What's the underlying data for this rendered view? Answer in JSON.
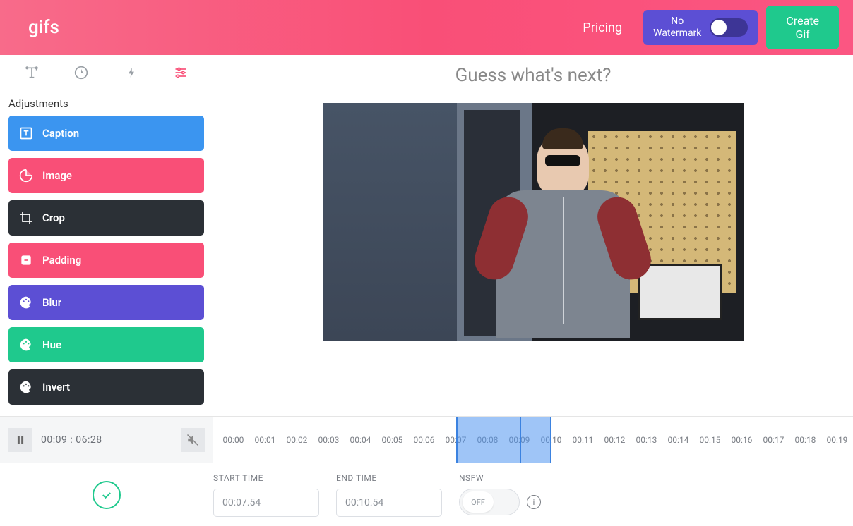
{
  "header": {
    "logo": "gifs",
    "pricing": "Pricing",
    "watermark_line1": "No",
    "watermark_line2": "Watermark",
    "create_line1": "Create",
    "create_line2": "Gif"
  },
  "sidebar": {
    "section_title": "Adjustments",
    "items": [
      {
        "label": "Caption"
      },
      {
        "label": "Image"
      },
      {
        "label": "Crop"
      },
      {
        "label": "Padding"
      },
      {
        "label": "Blur"
      },
      {
        "label": "Hue"
      },
      {
        "label": "Invert"
      }
    ]
  },
  "preview": {
    "title": "Guess what's next?"
  },
  "playback": {
    "current": "00:09",
    "sep": ":",
    "total": "06:28"
  },
  "timeline": {
    "ticks": [
      "00:00",
      "00:01",
      "00:02",
      "00:03",
      "00:04",
      "00:05",
      "00:06",
      "00:07",
      "00:08",
      "00:09",
      "00:10",
      "00:11",
      "00:12",
      "00:13",
      "00:14",
      "00:15",
      "00:16",
      "00:17",
      "00:18",
      "00:19"
    ],
    "selection_start_index": 7.5,
    "selection_end_index": 10.5,
    "playhead_index": 9
  },
  "form": {
    "start_label": "START TIME",
    "start_value": "00:07.54",
    "end_label": "END TIME",
    "end_value": "00:10.54",
    "nsfw_label": "NSFW",
    "nsfw_value": "OFF"
  }
}
